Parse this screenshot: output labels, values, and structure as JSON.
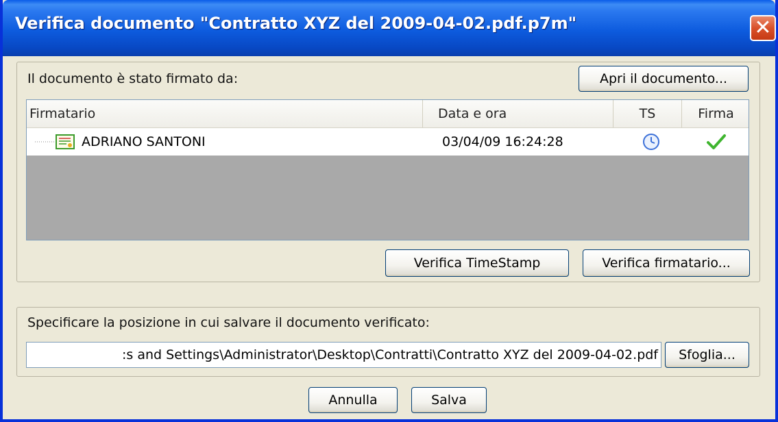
{
  "window": {
    "title": "Verifica documento \"Contratto XYZ del 2009-04-02.pdf.p7m\"",
    "close_glyph": "✕"
  },
  "signers": {
    "label": "Il documento è stato firmato da:",
    "open_document_button": "Apri il documento...",
    "columns": [
      "Firmatario",
      "Data e ora",
      "TS",
      "Firma"
    ],
    "rows": [
      {
        "signer": "ADRIANO SANTONI",
        "datetime": "03/04/09 16:24:28",
        "ts_icon": "clock-icon",
        "signature_icon": "checkmark-icon"
      }
    ],
    "verify_timestamp_button": "Verifica TimeStamp",
    "verify_signer_button": "Verifica firmatario..."
  },
  "save": {
    "label": "Specificare la posizione in cui salvare il documento verificato:",
    "path_value": ":s and Settings\\Administrator\\Desktop\\Contratti\\Contratto XYZ del 2009-04-02.pdf",
    "browse_button": "Sfoglia..."
  },
  "footer": {
    "cancel_button": "Annulla",
    "save_button": "Salva"
  },
  "colors": {
    "titlebar": "#0a5ce8",
    "window_bg": "#ece9d8",
    "table_empty": "#a9a9a9",
    "check": "#3fb52f",
    "clock": "#3a6fd8"
  }
}
